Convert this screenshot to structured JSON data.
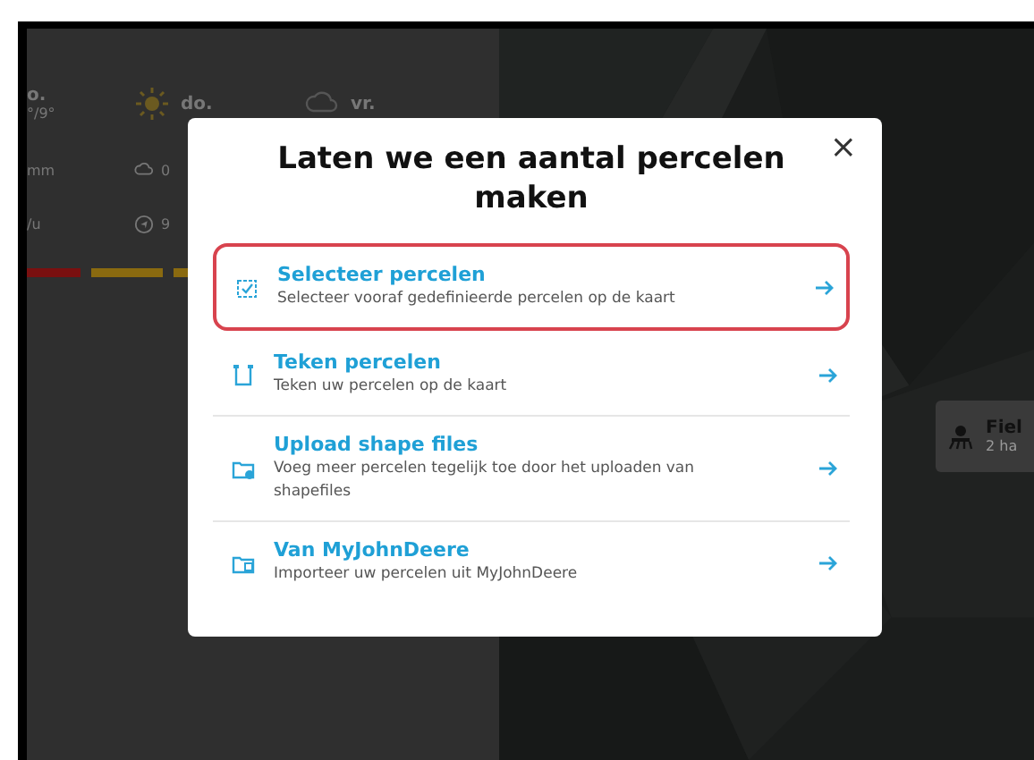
{
  "weather": {
    "days": [
      {
        "day": "o.",
        "temps": "°/9°",
        "rain": "mm",
        "wind": "/u",
        "kind": "none"
      },
      {
        "day": "do.",
        "rain": "0",
        "wind": "9",
        "kind": "sun"
      },
      {
        "day": "vr.",
        "kind": "cloud"
      }
    ],
    "bars": [
      {
        "color": "#7a1010"
      },
      {
        "color": "#8a6a10"
      },
      {
        "color": "#8a6a10"
      }
    ]
  },
  "map": {
    "field_card": {
      "name": "Fiel",
      "area": "2 ha"
    }
  },
  "dialog": {
    "title": "Laten we een aantal percelen maken",
    "close": "×",
    "options": [
      {
        "kind": "select",
        "title": "Selecteer percelen",
        "description": "Selecteer vooraf gedefinieerde percelen op de kaart",
        "selected": true
      },
      {
        "kind": "draw",
        "title": "Teken percelen",
        "description": "Teken uw percelen op de kaart",
        "selected": false
      },
      {
        "kind": "upload",
        "title": "Upload shape files",
        "description": "Voeg meer percelen tegelijk toe door het uploaden van shapefiles",
        "selected": false
      },
      {
        "kind": "import",
        "title": "Van MyJohnDeere",
        "description": "Importeer uw percelen uit MyJohnDeere",
        "selected": false
      }
    ]
  }
}
